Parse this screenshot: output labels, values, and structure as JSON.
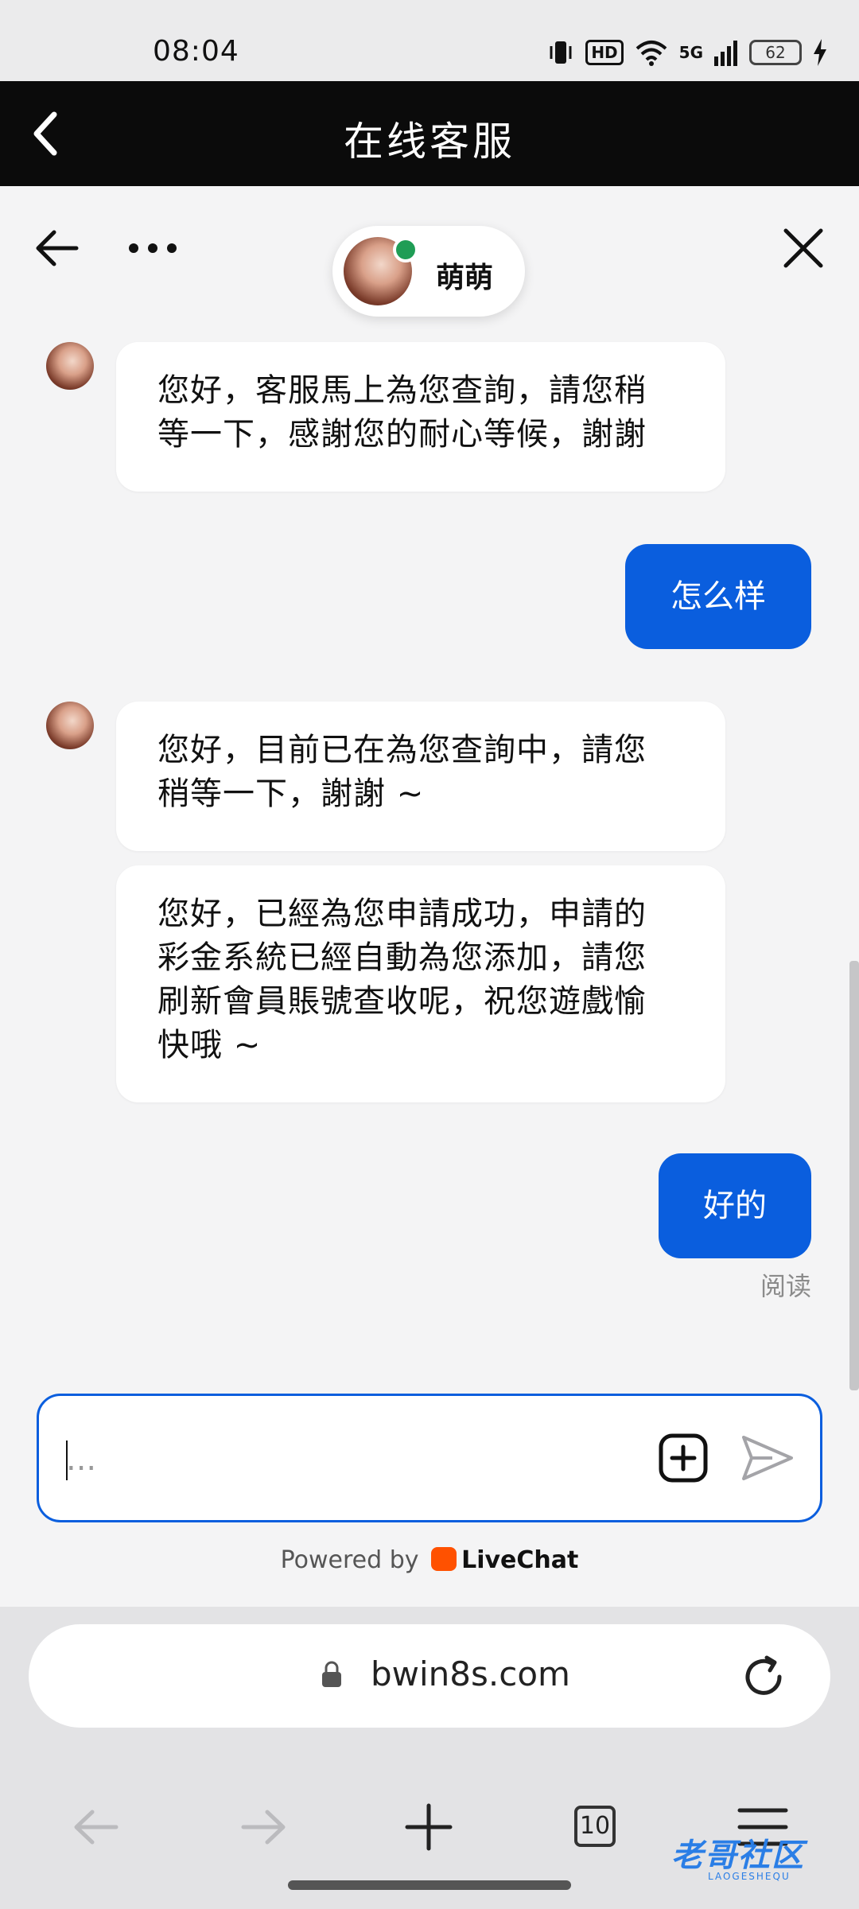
{
  "status_bar": {
    "time": "08:04",
    "hd": "HD",
    "network": "5G",
    "battery": "62"
  },
  "header": {
    "title": "在线客服"
  },
  "chat": {
    "agent_name": "萌萌",
    "messages": [
      {
        "from": "agent",
        "text": "您好，客服馬上為您查詢，請您稍\n等一下，感謝您的耐心等候，謝謝"
      },
      {
        "from": "user",
        "text": "怎么样"
      },
      {
        "from": "agent",
        "text": "您好，目前已在為您查詢中，請您\n稍等一下，謝謝 ~"
      },
      {
        "from": "agent",
        "text": "您好，已經為您申請成功，申請的\n彩金系統已經自動為您添加，請您\n刷新會員賬號查收呢，祝您遊戲愉\n快哦 ~"
      },
      {
        "from": "user",
        "text": "好的"
      }
    ],
    "read_status": "阅读",
    "input": {
      "value": "",
      "placeholder": "..."
    },
    "powered_by": "Powered by",
    "powered_brand": "LiveChat"
  },
  "browser": {
    "url": "bwin8s.com",
    "tab_count": "10"
  },
  "watermark": {
    "text": "老哥社区",
    "sub": "LAOGESHEQU"
  },
  "colors": {
    "accent": "#0a5ede",
    "header_bg": "#0b0b0b",
    "online": "#1f9d55"
  }
}
